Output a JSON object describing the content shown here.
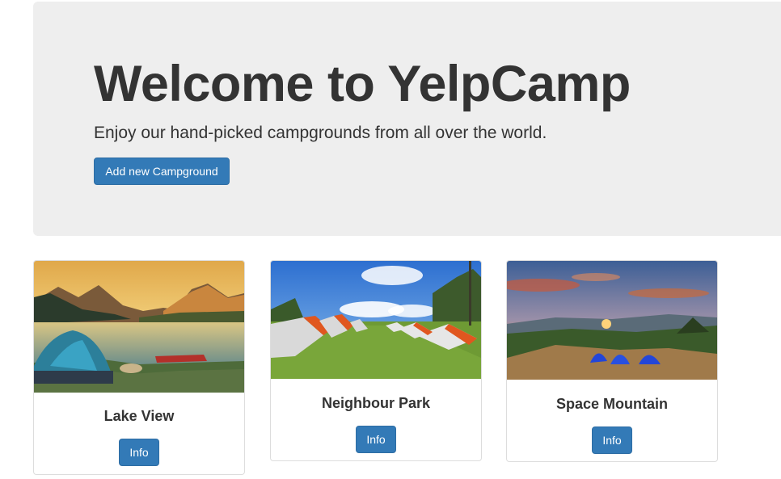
{
  "jumbotron": {
    "title": "Welcome to YelpCamp",
    "subtitle": "Enjoy our hand-picked campgrounds from all over the world.",
    "add_button_label": "Add new Campground"
  },
  "campgrounds": [
    {
      "name": "Lake View",
      "info_label": "Info"
    },
    {
      "name": "Neighbour Park",
      "info_label": "Info"
    },
    {
      "name": "Space Mountain",
      "info_label": "Info"
    }
  ],
  "colors": {
    "primary": "#337ab7",
    "jumbotron_bg": "#eeeeee",
    "text": "#333333"
  }
}
